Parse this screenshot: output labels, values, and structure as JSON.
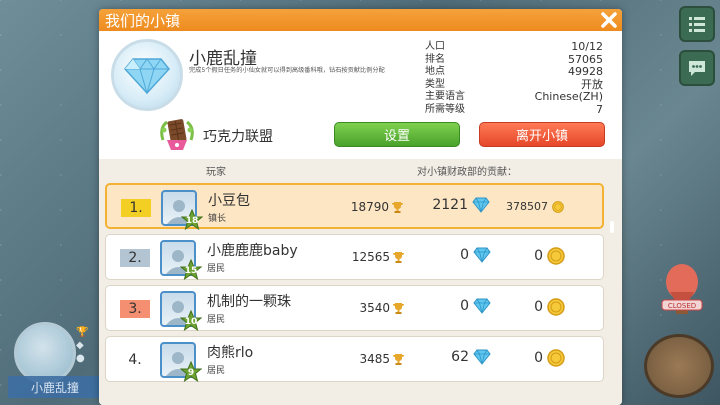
{
  "dialog": {
    "title": "我们的小镇"
  },
  "town": {
    "name": "小鹿乱撞",
    "description": "完成5个假日任务的小仙女就可以得到高级番科哦，钻石按贡献比例分配",
    "guild": "巧克力联盟",
    "info": [
      {
        "label": "人口",
        "value": "10/12"
      },
      {
        "label": "排名",
        "value": "57065"
      },
      {
        "label": "地点",
        "value": "49928"
      },
      {
        "label": "类型",
        "value": "开放"
      },
      {
        "label": "主要语言",
        "value": "Chinese(ZH)"
      },
      {
        "label": "所需等级",
        "value": "7"
      }
    ]
  },
  "buttons": {
    "settings": "设置",
    "leave": "离开小镇"
  },
  "list": {
    "col_player": "玩家",
    "col_contribution": "对小镇财政部的贡献："
  },
  "players": [
    {
      "rank": "1.",
      "name": "小豆包",
      "role": "镇长",
      "level": "18",
      "trophies": "18790",
      "gems": "2121",
      "coins": "378507"
    },
    {
      "rank": "2.",
      "name": "小鹿鹿鹿baby",
      "role": "居民",
      "level": "15",
      "trophies": "12565",
      "gems": "0",
      "coins": "0"
    },
    {
      "rank": "3.",
      "name": "机制的一颗珠",
      "role": "居民",
      "level": "10",
      "trophies": "3540",
      "gems": "0",
      "coins": "0"
    },
    {
      "rank": "4.",
      "name": "肉熊rlo",
      "role": "居民",
      "level": "9",
      "trophies": "3485",
      "gems": "62",
      "coins": "0"
    }
  ],
  "background": {
    "town_label": "小鹿乱撞",
    "closed_sign": "CLOSED"
  },
  "colors": {
    "header": "#f29a2e",
    "settings_button": "#5fb83a",
    "leave_button": "#f05a36",
    "highlight_row": "#fde6c4"
  }
}
